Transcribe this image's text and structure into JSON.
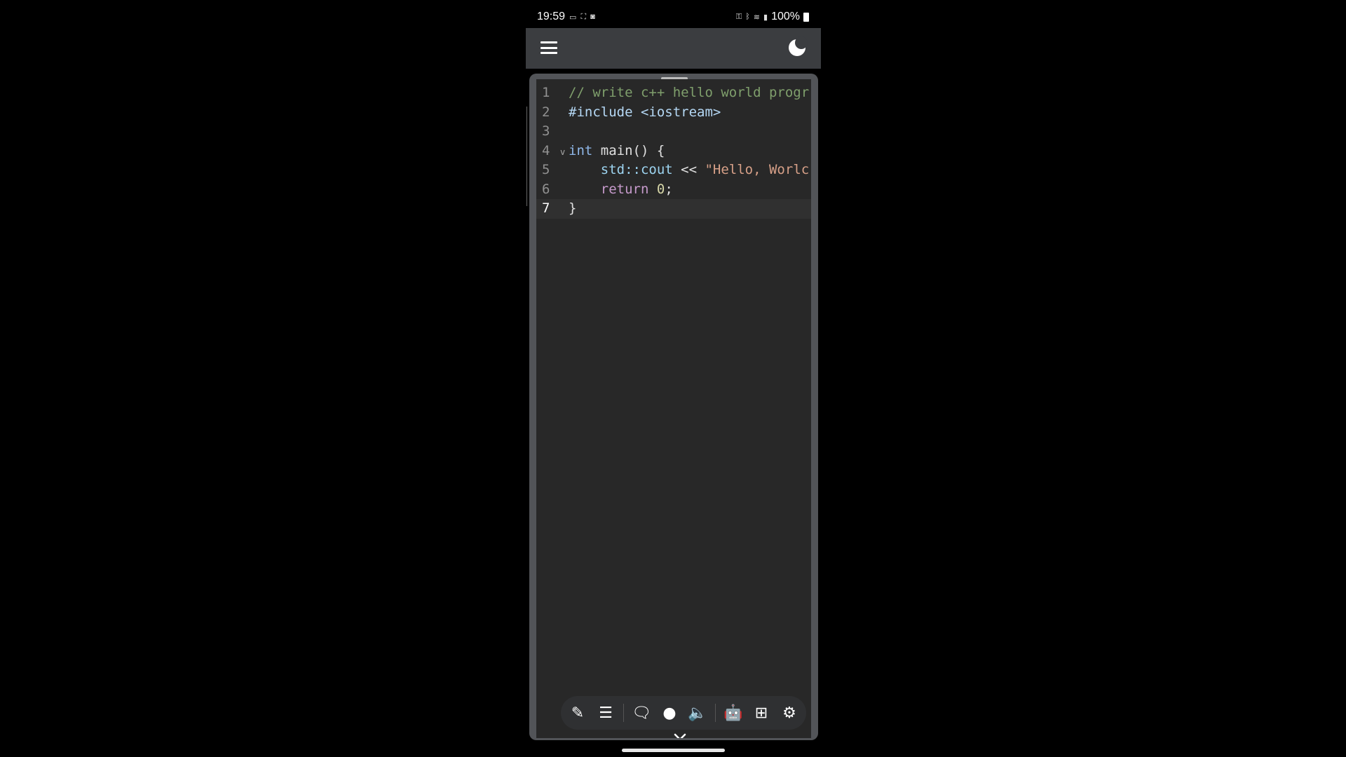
{
  "status": {
    "time": "19:59",
    "battery": "100%"
  },
  "appbar": {
    "menu_icon": "hamburger-menu-icon",
    "theme_icon": "moon-icon"
  },
  "editor": {
    "lines": [
      {
        "no": "1",
        "tokens": [
          {
            "cls": "t-comment",
            "text": "// write c++ hello world progr"
          }
        ]
      },
      {
        "no": "2",
        "tokens": [
          {
            "cls": "t-pre",
            "text": "#include "
          },
          {
            "cls": "t-pre",
            "text": "<iostream>"
          }
        ]
      },
      {
        "no": "3",
        "tokens": []
      },
      {
        "no": "4",
        "fold": "v",
        "tokens": [
          {
            "cls": "t-kw",
            "text": "int"
          },
          {
            "cls": "",
            "text": " main() {"
          }
        ]
      },
      {
        "no": "5",
        "tokens": [
          {
            "cls": "",
            "text": "    "
          },
          {
            "cls": "t-ns",
            "text": "std::cout"
          },
          {
            "cls": "",
            "text": " << "
          },
          {
            "cls": "t-str",
            "text": "\"Hello, Worlc"
          }
        ]
      },
      {
        "no": "6",
        "tokens": [
          {
            "cls": "",
            "text": "    "
          },
          {
            "cls": "t-ret",
            "text": "return"
          },
          {
            "cls": "",
            "text": " "
          },
          {
            "cls": "t-num",
            "text": "0"
          },
          {
            "cls": "",
            "text": ";"
          }
        ]
      },
      {
        "no": "7",
        "active": true,
        "tokens": [
          {
            "cls": "",
            "text": "}"
          }
        ]
      }
    ]
  },
  "toolbar": {
    "buttons": [
      {
        "name": "edit-pencil-icon",
        "glyph": "✎"
      },
      {
        "name": "text-lines-icon",
        "glyph": "☰"
      },
      {
        "sep": true
      },
      {
        "name": "chat-bubbles-icon",
        "glyph": "🗨"
      },
      {
        "name": "microphone-icon",
        "glyph": "●"
      },
      {
        "name": "speaker-icon",
        "glyph": "🔈"
      },
      {
        "sep": true
      },
      {
        "name": "robot-icon",
        "glyph": "🤖"
      },
      {
        "name": "grid-add-icon",
        "glyph": "⊞"
      },
      {
        "name": "gear-icon",
        "glyph": "⚙"
      }
    ]
  }
}
